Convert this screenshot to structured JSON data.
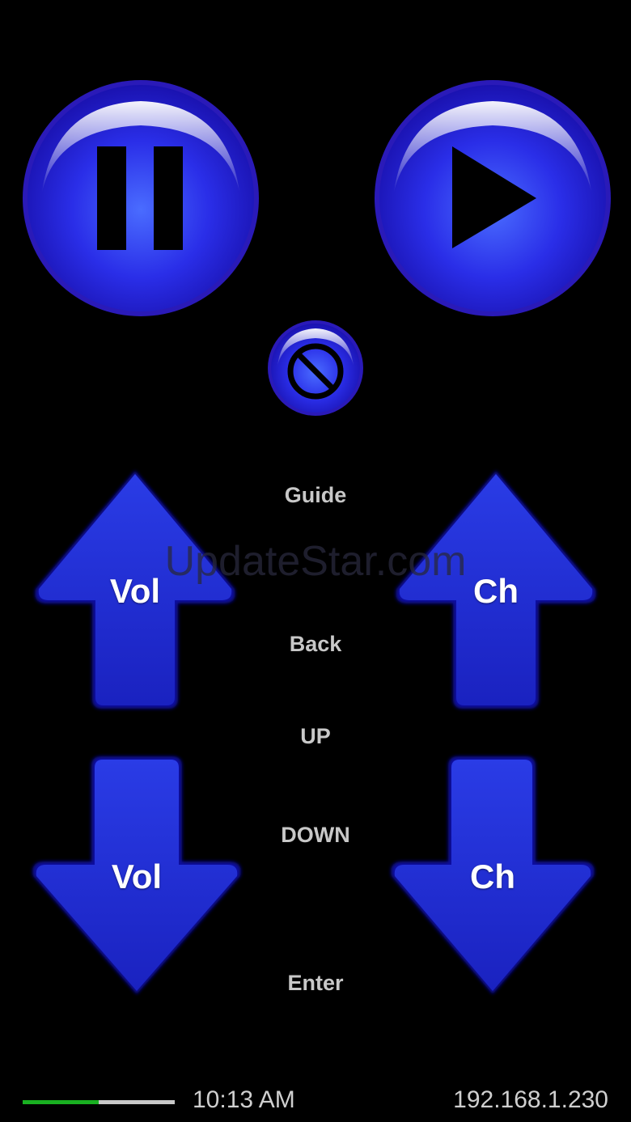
{
  "controls": {
    "pause_icon": "pause-icon",
    "play_icon": "play-icon",
    "mute_icon": "mute-prohibited-icon"
  },
  "arrows": {
    "vol_up": "Vol",
    "ch_up": "Ch",
    "vol_down": "Vol",
    "ch_down": "Ch"
  },
  "nav": {
    "guide": "Guide",
    "back": "Back",
    "up": "UP",
    "down": "DOWN",
    "enter": "Enter"
  },
  "watermark": "UpdateStar.com",
  "status": {
    "time": "10:13 AM",
    "ip": "192.168.1.230",
    "progress_fraction": 0.5
  },
  "colors": {
    "button_blue": "#2a2ee8",
    "button_dark_blue": "#1414a8",
    "arrow_blue": "#1f2fd8",
    "progress_green": "#19b021",
    "background": "#000000"
  }
}
